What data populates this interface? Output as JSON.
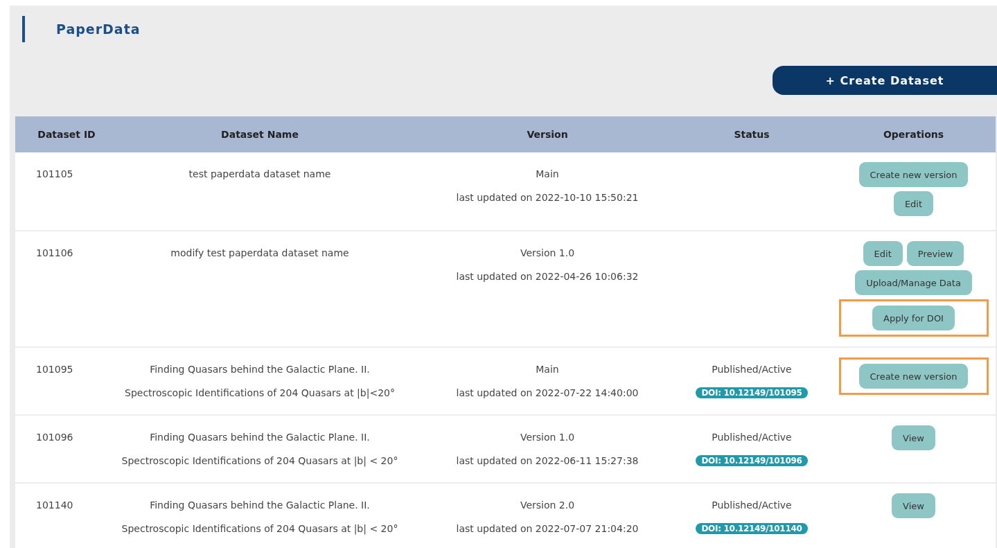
{
  "title": "PaperData",
  "create_button": {
    "label": "+ Create Dataset"
  },
  "table": {
    "columns": [
      "Dataset ID",
      "Dataset Name",
      "Version",
      "Status",
      "Operations"
    ],
    "rows": [
      {
        "id": "101105",
        "name": [
          "test paperdata dataset name"
        ],
        "version": "Main",
        "updated": "last updated on 2022-10-10 15:50:21",
        "operations": [
          {
            "highlighted": false,
            "buttons": [
              "Create new version"
            ]
          },
          {
            "highlighted": false,
            "buttons": [
              "Edit"
            ]
          }
        ]
      },
      {
        "id": "101106",
        "name": [
          "modify test paperdata dataset name"
        ],
        "version": "Version 1.0",
        "updated": "last updated on 2022-04-26 10:06:32",
        "operations": [
          {
            "highlighted": false,
            "buttons": [
              "Edit",
              "Preview"
            ]
          },
          {
            "highlighted": false,
            "buttons": [
              "Upload/Manage Data"
            ]
          },
          {
            "highlighted": true,
            "buttons": [
              "Apply for DOI"
            ]
          }
        ]
      },
      {
        "id": "101095",
        "name": [
          "Finding Quasars behind the Galactic Plane. II.",
          "Spectroscopic Identifications of 204 Quasars at |b|<20°"
        ],
        "version": "Main",
        "updated": "last updated on 2022-07-22 14:40:00",
        "status": "Published/Active",
        "doi": "DOI: 10.12149/101095",
        "operations": [
          {
            "highlighted": true,
            "buttons": [
              "Create new version"
            ]
          }
        ]
      },
      {
        "id": "101096",
        "name": [
          "Finding Quasars behind the Galactic Plane. II.",
          "Spectroscopic Identifications of 204 Quasars at |b| < 20°"
        ],
        "version": "Version 1.0",
        "updated": "last updated on 2022-06-11 15:27:38",
        "status": "Published/Active",
        "doi": "DOI: 10.12149/101096",
        "operations": [
          {
            "highlighted": false,
            "buttons": [
              "View"
            ]
          }
        ]
      },
      {
        "id": "101140",
        "name": [
          "Finding Quasars behind the Galactic Plane. II.",
          "Spectroscopic Identifications of 204 Quasars at |b| < 20°"
        ],
        "version": "Version 2.0",
        "updated": "last updated on 2022-07-07 21:04:20",
        "status": "Published/Active",
        "doi": "DOI: 10.12149/101140",
        "operations": [
          {
            "highlighted": false,
            "buttons": [
              "View"
            ]
          }
        ]
      }
    ]
  }
}
